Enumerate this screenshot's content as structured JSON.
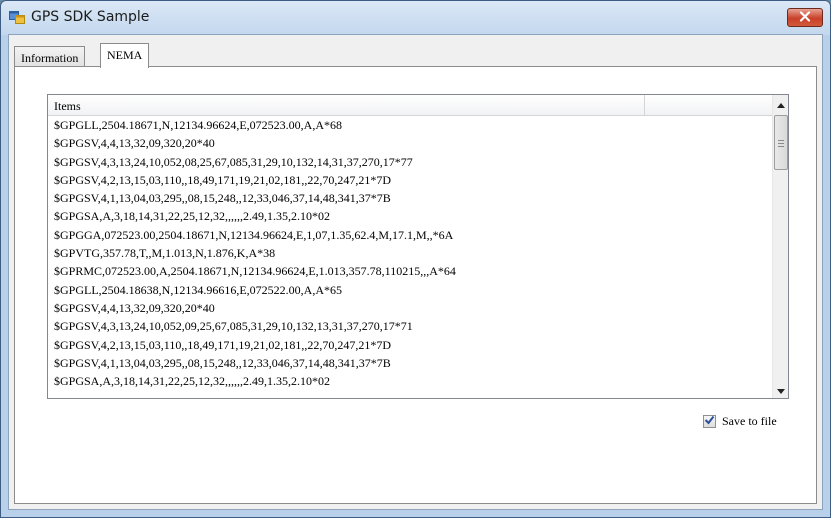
{
  "window": {
    "title": "GPS SDK Sample",
    "icon": "app-window-icon",
    "close_icon": "close-icon"
  },
  "tabs": [
    {
      "label": "Information",
      "selected": false
    },
    {
      "label": "NEMA",
      "selected": true
    }
  ],
  "list": {
    "column_header": "Items",
    "rows": [
      "$GPGLL,2504.18671,N,12134.96624,E,072523.00,A,A*68",
      "$GPGSV,4,4,13,32,09,320,20*40",
      "$GPGSV,4,3,13,24,10,052,08,25,67,085,31,29,10,132,14,31,37,270,17*77",
      "$GPGSV,4,2,13,15,03,110,,18,49,171,19,21,02,181,,22,70,247,21*7D",
      "$GPGSV,4,1,13,04,03,295,,08,15,248,,12,33,046,37,14,48,341,37*7B",
      "$GPGSA,A,3,18,14,31,22,25,12,32,,,,,,2.49,1.35,2.10*02",
      "$GPGGA,072523.00,2504.18671,N,12134.96624,E,1,07,1.35,62.4,M,17.1,M,,*6A",
      "$GPVTG,357.78,T,,M,1.013,N,1.876,K,A*38",
      "$GPRMC,072523.00,A,2504.18671,N,12134.96624,E,1.013,357.78,110215,,,A*64",
      "$GPGLL,2504.18638,N,12134.96616,E,072522.00,A,A*65",
      "$GPGSV,4,4,13,32,09,320,20*40",
      "$GPGSV,4,3,13,24,10,052,09,25,67,085,31,29,10,132,13,31,37,270,17*71",
      "$GPGSV,4,2,13,15,03,110,,18,49,171,19,21,02,181,,22,70,247,21*7D",
      "$GPGSV,4,1,13,04,03,295,,08,15,248,,12,33,046,37,14,48,341,37*7B",
      "$GPGSA,A,3,18,14,31,22,25,12,32,,,,,,2.49,1.35,2.10*02"
    ]
  },
  "save_to_file": {
    "label": "Save to file",
    "checked": true
  },
  "colors": {
    "title_gradient_top": "#dbe8f6",
    "close_button": "#c9402a",
    "checkmark": "#2a4f9e"
  }
}
